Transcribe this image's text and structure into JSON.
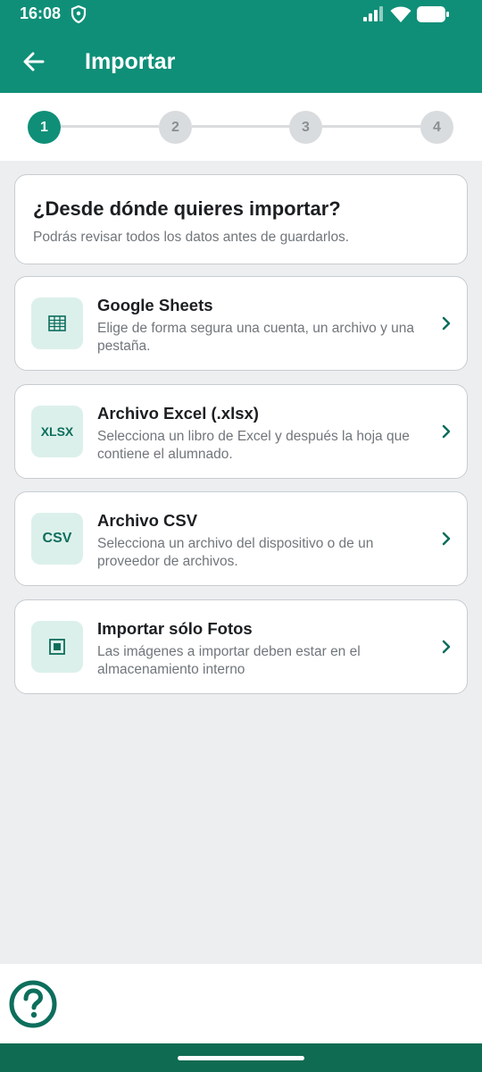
{
  "status": {
    "time": "16:08"
  },
  "appbar": {
    "title": "Importar"
  },
  "stepper": {
    "steps": [
      "1",
      "2",
      "3",
      "4"
    ],
    "active_step": 1
  },
  "header": {
    "question": "¿Desde dónde quieres importar?",
    "subtitle": "Podrás revisar todos los datos antes de guardarlos."
  },
  "options": [
    {
      "icon": "grid-icon",
      "icon_text": "",
      "title": "Google Sheets",
      "description": "Elige de forma segura una cuenta, un archivo y una pestaña."
    },
    {
      "icon": "xlsx-icon",
      "icon_text": "XLSX",
      "title": "Archivo Excel (.xlsx)",
      "description": "Selecciona un libro de Excel y después la hoja que contiene el alumnado."
    },
    {
      "icon": "csv-icon",
      "icon_text": "CSV",
      "title": "Archivo CSV",
      "description": "Selecciona un archivo del dispositivo o de un proveedor de archivos."
    },
    {
      "icon": "photo-icon",
      "icon_text": "",
      "title": "Importar sólo Fotos",
      "description": "Las imágenes a importar deben estar en el almacenamiento interno"
    }
  ],
  "colors": {
    "primary": "#0f8f78",
    "nav": "#0f6b52",
    "icon_bg": "#dcf0eb",
    "icon_fg": "#0d6e5c"
  }
}
